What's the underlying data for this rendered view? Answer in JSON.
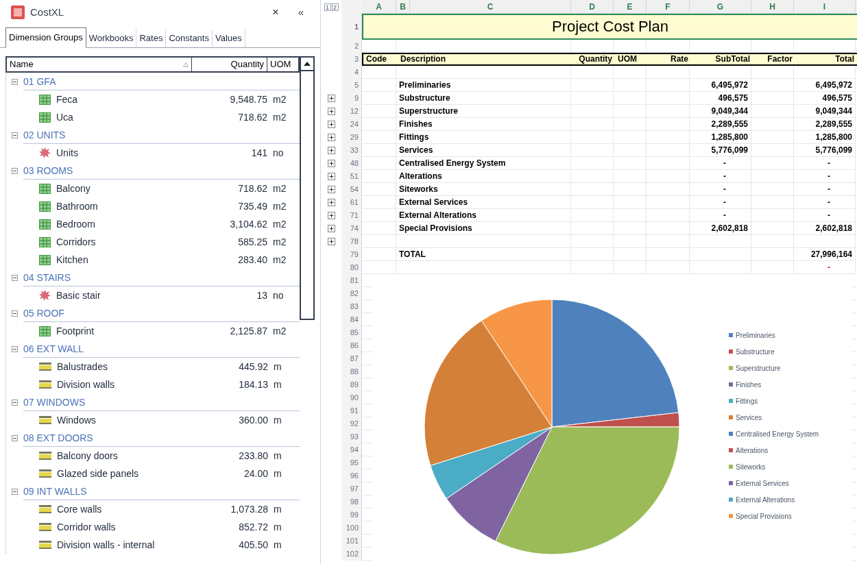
{
  "panel": {
    "title": "CostXL",
    "close": "×",
    "collapse": "«",
    "tabs": [
      {
        "label": "Dimension Groups",
        "selected": true
      },
      {
        "label": "Workbooks",
        "selected": false
      },
      {
        "label": "Rates",
        "selected": false
      },
      {
        "label": "Constants",
        "selected": false
      },
      {
        "label": "Values",
        "selected": false
      }
    ],
    "columns": [
      {
        "label": "Name",
        "sorted": true
      },
      {
        "label": "Quantity",
        "sorted": false
      },
      {
        "label": "UOM",
        "sorted": false
      }
    ],
    "groups": [
      {
        "name": "01 GFA",
        "expanded": true,
        "items": [
          {
            "name": "Feca",
            "quantity": "9,548.75",
            "uom": "m2",
            "kind": "area"
          },
          {
            "name": "Uca",
            "quantity": "718.62",
            "uom": "m2",
            "kind": "area"
          }
        ]
      },
      {
        "name": "02 UNITS",
        "expanded": true,
        "items": [
          {
            "name": "Units",
            "quantity": "141",
            "uom": "no",
            "kind": "count"
          }
        ]
      },
      {
        "name": "03 ROOMS",
        "expanded": true,
        "items": [
          {
            "name": "Balcony",
            "quantity": "718.62",
            "uom": "m2",
            "kind": "area"
          },
          {
            "name": "Bathroom",
            "quantity": "735.49",
            "uom": "m2",
            "kind": "area"
          },
          {
            "name": "Bedroom",
            "quantity": "3,104.62",
            "uom": "m2",
            "kind": "area"
          },
          {
            "name": "Corridors",
            "quantity": "585.25",
            "uom": "m2",
            "kind": "area"
          },
          {
            "name": "Kitchen",
            "quantity": "283.40",
            "uom": "m2",
            "kind": "area"
          }
        ]
      },
      {
        "name": "04 STAIRS",
        "expanded": true,
        "items": [
          {
            "name": "Basic stair",
            "quantity": "13",
            "uom": "no",
            "kind": "count"
          }
        ]
      },
      {
        "name": "05 ROOF",
        "expanded": true,
        "items": [
          {
            "name": "Footprint",
            "quantity": "2,125.87",
            "uom": "m2",
            "kind": "area"
          }
        ]
      },
      {
        "name": "06 EXT WALL",
        "expanded": true,
        "items": [
          {
            "name": "Balustrades",
            "quantity": "445.92",
            "uom": "m",
            "kind": "linear"
          },
          {
            "name": "Division walls",
            "quantity": "184.13",
            "uom": "m",
            "kind": "linear"
          }
        ]
      },
      {
        "name": "07 WINDOWS",
        "expanded": true,
        "items": [
          {
            "name": "Windows",
            "quantity": "360.00",
            "uom": "m",
            "kind": "linear"
          }
        ]
      },
      {
        "name": "08 EXT DOORS",
        "expanded": true,
        "items": [
          {
            "name": "Balcony doors",
            "quantity": "233.80",
            "uom": "m",
            "kind": "linear"
          },
          {
            "name": "Glazed side panels",
            "quantity": "24.00",
            "uom": "m",
            "kind": "linear"
          }
        ]
      },
      {
        "name": "09 INT WALLS",
        "expanded": true,
        "items": [
          {
            "name": "Core walls",
            "quantity": "1,073.28",
            "uom": "m",
            "kind": "linear"
          },
          {
            "name": "Corridor walls",
            "quantity": "852.72",
            "uom": "m",
            "kind": "linear"
          },
          {
            "name": "Division walls - internal",
            "quantity": "405.50",
            "uom": "m",
            "kind": "linear"
          }
        ]
      }
    ]
  },
  "sheet": {
    "outline_levels": [
      "1",
      "2"
    ],
    "columns": [
      "A",
      "B",
      "C",
      "D",
      "E",
      "F",
      "G",
      "H",
      "I"
    ],
    "rows": [
      {
        "kind": "title",
        "number": "1",
        "text": "Project Cost Plan"
      },
      {
        "kind": "blank",
        "number": "2"
      },
      {
        "kind": "header",
        "number": "3",
        "cells": [
          "Code",
          "Description",
          "Quantity",
          "UOM",
          "Rate",
          "SubTotal",
          "Factor",
          "Total"
        ]
      },
      {
        "kind": "blank",
        "number": "4"
      },
      {
        "kind": "data",
        "number": "5",
        "expander": false,
        "description": "Preliminaries",
        "subtotal": "6,495,972",
        "total": "6,495,972"
      },
      {
        "kind": "data",
        "number": "9",
        "expander": true,
        "description": "Substructure",
        "subtotal": "496,575",
        "total": "496,575"
      },
      {
        "kind": "data",
        "number": "12",
        "expander": true,
        "description": "Superstructure",
        "subtotal": "9,049,344",
        "total": "9,049,344"
      },
      {
        "kind": "data",
        "number": "24",
        "expander": true,
        "description": "Finishes",
        "subtotal": "2,289,555",
        "total": "2,289,555"
      },
      {
        "kind": "data",
        "number": "29",
        "expander": true,
        "description": "Fittings",
        "subtotal": "1,285,800",
        "total": "1,285,800"
      },
      {
        "kind": "data",
        "number": "33",
        "expander": true,
        "description": "Services",
        "subtotal": "5,776,099",
        "total": "5,776,099"
      },
      {
        "kind": "data",
        "number": "48",
        "expander": true,
        "description": "Centralised Energy System",
        "subtotal": "-",
        "total": "-"
      },
      {
        "kind": "data",
        "number": "51",
        "expander": true,
        "description": "Alterations",
        "subtotal": "-",
        "total": "-"
      },
      {
        "kind": "data",
        "number": "54",
        "expander": true,
        "description": "Siteworks",
        "subtotal": "-",
        "total": "-"
      },
      {
        "kind": "data",
        "number": "61",
        "expander": true,
        "description": "External Services",
        "subtotal": "-",
        "total": "-"
      },
      {
        "kind": "data",
        "number": "71",
        "expander": true,
        "description": "External Alterations",
        "subtotal": "-",
        "total": "-"
      },
      {
        "kind": "data",
        "number": "74",
        "expander": true,
        "description": "Special Provisions",
        "subtotal": "2,602,818",
        "total": "2,602,818"
      },
      {
        "kind": "blank",
        "number": "78",
        "expander": true
      },
      {
        "kind": "data",
        "number": "79",
        "expander": false,
        "description": "TOTAL",
        "total": "27,996,164"
      },
      {
        "kind": "alert",
        "number": "80",
        "total": "-"
      }
    ],
    "more_rows": [
      "81",
      "82",
      "83",
      "84",
      "85",
      "86",
      "87",
      "88",
      "89",
      "90",
      "91",
      "92",
      "93",
      "94",
      "95",
      "96",
      "97",
      "98",
      "99",
      "100",
      "101",
      "102"
    ],
    "chart": {
      "slices": [
        {
          "color": "#4f81bd"
        },
        {
          "color": "#c0504d"
        },
        {
          "color": "#9bbb59"
        },
        {
          "color": "#8064a2"
        },
        {
          "color": "#4bacc6"
        },
        {
          "color": "#d58038"
        },
        {
          "color": "#4f81bd"
        },
        {
          "color": "#c0504d"
        },
        {
          "color": "#9bbb59"
        },
        {
          "color": "#8064a2"
        },
        {
          "color": "#4bacc6"
        },
        {
          "color": "#f79646"
        }
      ],
      "chart_data": {
        "type": "pie",
        "legend": true,
        "categories": [
          "Preliminaries",
          "Substructure",
          "Superstructure",
          "Finishes",
          "Fittings",
          "Services",
          "Centralised Energy System",
          "Alterations",
          "Siteworks",
          "External Services",
          "External Alterations",
          "Special Provisions"
        ],
        "values": [
          23.2,
          1.8,
          32.3,
          8.2,
          4.6,
          20.6,
          0,
          0,
          0,
          0,
          0,
          9.3
        ]
      }
    }
  }
}
